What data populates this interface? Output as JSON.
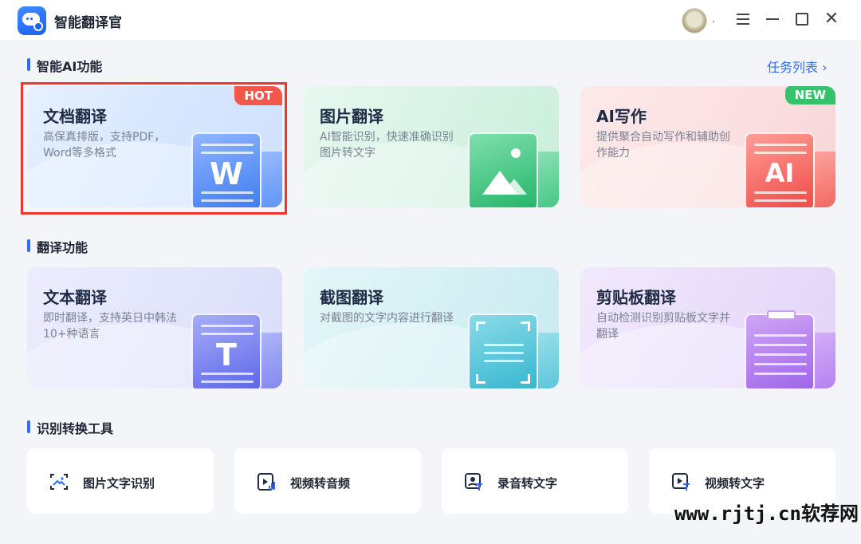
{
  "app": {
    "title": "智能翻译官",
    "avatar_suffix": "."
  },
  "sections": {
    "ai": {
      "title": "智能AI功能",
      "link": "任务列表 ›"
    },
    "translate": {
      "title": "翻译功能"
    },
    "tools": {
      "title": "识别转换工具"
    }
  },
  "ai_cards": [
    {
      "title": "文档翻译",
      "desc": "高保真排版，支持PDF，Word等多格式",
      "badge": "HOT",
      "glyph": "W"
    },
    {
      "title": "图片翻译",
      "desc": "AI智能识别，快速准确识别图片转文字"
    },
    {
      "title": "AI写作",
      "desc": "提供聚合自动写作和辅助创作能力",
      "badge": "NEW",
      "glyph": "AI"
    }
  ],
  "translate_cards": [
    {
      "title": "文本翻译",
      "desc": "即时翻译，支持英日中韩法10+种语言",
      "glyph": "T"
    },
    {
      "title": "截图翻译",
      "desc": "对截图的文字内容进行翻译"
    },
    {
      "title": "剪贴板翻译",
      "desc": "自动检测识别剪贴板文字并翻译"
    }
  ],
  "tools": [
    {
      "label": "图片文字识别",
      "icon": "image-scan-icon"
    },
    {
      "label": "视频转音频",
      "icon": "video-audio-icon"
    },
    {
      "label": "录音转文字",
      "icon": "recording-text-icon"
    },
    {
      "label": "视频转文字",
      "icon": "video-text-icon"
    }
  ],
  "watermark": "www.rjtj.cn软荐网",
  "colors": {
    "accent": "#2f6bff",
    "hot": "#f2574a",
    "new": "#36c26b",
    "selected": "#f0362a"
  }
}
